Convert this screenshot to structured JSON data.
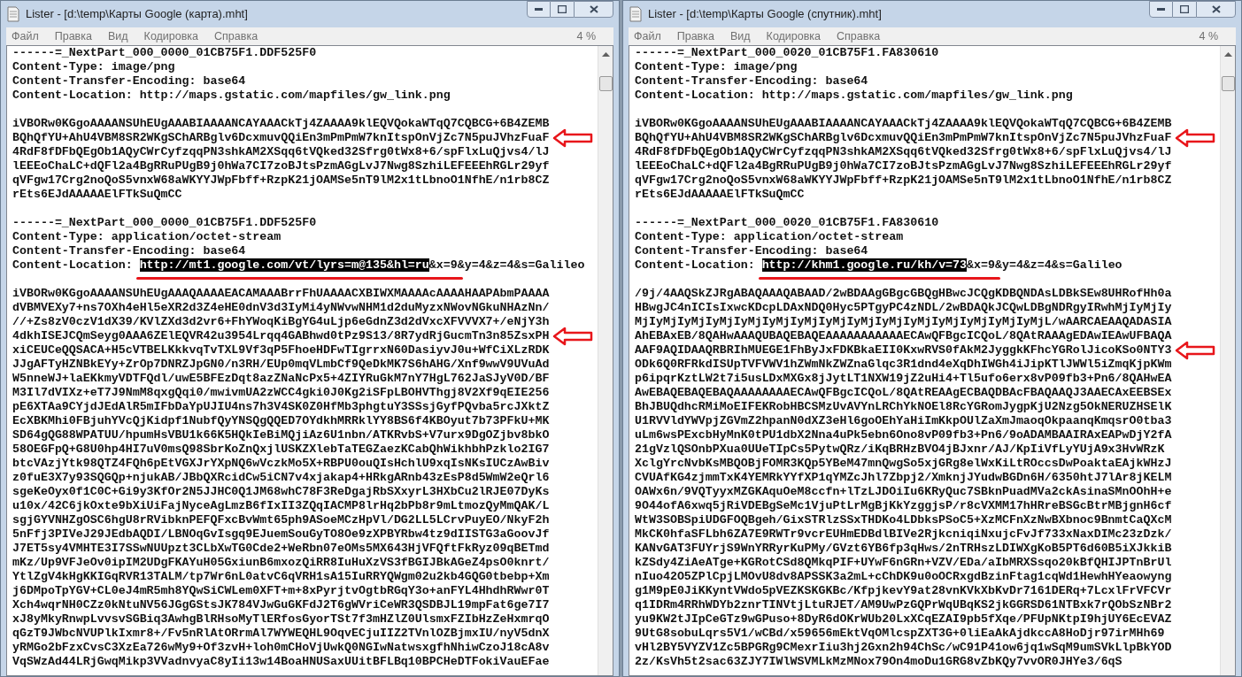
{
  "windows": [
    {
      "title": "Lister - [d:\\temp\\Карты Google (карта).mht]",
      "menu": [
        "Файл",
        "Правка",
        "Вид",
        "Кодировка",
        "Справка"
      ],
      "zoom": "4 %",
      "blocks": [
        {
          "lines": [
            {
              "kind": "plain",
              "text": "------=_NextPart_000_0000_01CB75F1.DDF525F0",
              "marked": false
            },
            {
              "kind": "plain",
              "text": "Content-Type: image/png",
              "marked": false
            },
            {
              "kind": "plain",
              "text": "Content-Transfer-Encoding: base64",
              "marked": false
            },
            {
              "kind": "plain",
              "text": "Content-Location: http://maps.gstatic.com/mapfiles/gw_link.png",
              "marked": false
            }
          ]
        },
        {
          "lines": [
            {
              "kind": "plain",
              "text": "iVBORw0KGgoAAAANSUhEUgAAABIAAAANCAYAAACkTj4ZAAAA9klEQVQokaWTqQ7CQBCG+6B4ZEMB",
              "marked": false
            },
            {
              "kind": "plain",
              "text": "BQhQfYU+AhU4VBM8SR2WKgSChARBglv6DcxmuvQQiEn3mPmPmW7knItspOnVjZc7N5puJVhzFuaF",
              "marked": true
            },
            {
              "kind": "plain",
              "text": "4RdF8fDFbQEgOb1AQyCWrCyfzqqPN3shkAM2XSqq6tVQked32Sfrg0tWx8+6/spFlxLuQjvs4/lJ",
              "marked": false
            },
            {
              "kind": "plain",
              "text": "lEEEoChaLC+dQFl2a4BgRRuPUgB9j0hWa7CI7zoBJtsPzmAGgLvJ7Nwg8SzhiLEFEEEhRGLr29yf",
              "marked": false
            },
            {
              "kind": "plain",
              "text": "qVFgw17Crg2noQoS5vnxW68aWKYYJWpFbff+RzpK21jOAMSe5nT9lM2x1tLbnoO1NfhE/n1rb8CZ",
              "marked": false
            },
            {
              "kind": "plain",
              "text": "rEts6EJdAAAAAElFTkSuQmCC",
              "marked": false
            }
          ]
        },
        {
          "lines": [
            {
              "kind": "plain",
              "text": "------=_NextPart_000_0000_01CB75F1.DDF525F0",
              "marked": false
            },
            {
              "kind": "plain",
              "text": "Content-Type: application/octet-stream",
              "marked": false
            },
            {
              "kind": "plain",
              "text": "Content-Transfer-Encoding: base64",
              "marked": false
            },
            {
              "kind": "location",
              "label": "Content-Location: ",
              "selection": "http://mt1.google.com/vt/lyrs=m@135&hl=ru",
              "rest": "&x=9&y=4&z=4&s=Galileo",
              "underlined": true,
              "marked": false
            }
          ]
        },
        {
          "lines": [
            {
              "kind": "plain",
              "text": "iVBORw0KGgoAAAANSUhEUgAAAQAAAAEACAMAAABrrFhUAAAACXBIWXMAAAAcAAAAHAAPAbmPAAAA",
              "marked": false
            },
            {
              "kind": "plain",
              "text": "dVBMVEXy7+ns7OXh4eHl5eXR2d3Z4eHE0dnV3d3IyMi4yNWvwNHM1d2duMyzxNWovNGkuNHAzNn/",
              "marked": false
            },
            {
              "kind": "plain",
              "text": "//+Zs8zV0czV1dX39/KVlZXd3d2vr6+FhYWoqKiBgYG4uLjp6eGdnZ3d2dVxcXFVVVX7+/eNjY3h",
              "marked": false
            },
            {
              "kind": "plain",
              "text": "4dkhISEJCQmSeyg0AAA6ZElEQVR42u3954Lrqq4GABhwd0tPz9S13/8R7ydRjGucmTn3n85ZsxPH",
              "marked": true
            },
            {
              "kind": "plain",
              "text": "xiCEUCeQQSACA+H5cVTBELKkkvqTvTXL9Vf3qP5FhoeHDFwTIgrrxN60DasiyvJ0u+WfCiXLzRDK",
              "marked": false
            },
            {
              "kind": "plain",
              "text": "JJgAFTyHZNBkEYy+ZrOp7DNRZJpGN0/n3RH/EUp0mqVLmbCf9QeDkMK7S6hAHG/Xnf9wwV9UVuAd",
              "marked": false
            },
            {
              "kind": "plain",
              "text": "W5nneWJ+laEKkmyVDTFQdl/uwE5BFEzDqt8azZNaNcPx5+4ZIYRuGkM7nY7HgL762JaSJyV0D/BF",
              "marked": false
            },
            {
              "kind": "plain",
              "text": "M3Il7dVIXz+eT7J9NmM8qxgQqi0/mwivmUA2zWCC4gki0J0Kg2iSFpLBOHVThgj8V2Xf9qEIE256",
              "marked": false
            },
            {
              "kind": "plain",
              "text": "pE6XTAa9CYjdJEdAlR5mIFbDaYpUJIU4ns7h3V4SK0Z0HfMb3phgtuY3SSsjGyfPQvba5rcJXktZ",
              "marked": false
            },
            {
              "kind": "plain",
              "text": "EcXBKMhi0FBjuhYVcQjKidpf1NubfQyYNSQgQQED7OYdkhMRRklYY8BS6f4KBOyut7b73PFkU+MK",
              "marked": false
            },
            {
              "kind": "plain",
              "text": "SD64gQG88WPATUU/hpumHsVBU1k66K5HQkIeBiMQjiAz6U1nbn/ATKRvbS+V7urx9DgOZjbv8bkO",
              "marked": false
            },
            {
              "kind": "plain",
              "text": "58OEGFpQ+G8U0hp4HI7uV0msQ98SbrKoZnQxjlUSKZXlebTaTEGZaezKCabQhWikhbhPzklo2IG7",
              "marked": false
            },
            {
              "kind": "plain",
              "text": "btcVAzjYtk98QTZ4FQh6pEtVGXJrYXpNQ6wVczkMo5X+RBPU0ouQIsHchlU9xqIsNKsIUCzAwBiv",
              "marked": false
            },
            {
              "kind": "plain",
              "text": "z0fuE3X7y93SQGQp+njukAB/JBbQXRcidCw5iCN7v4xjakap4+HRkgARnb43zEsP8d5WmW2eQrl6",
              "marked": false
            },
            {
              "kind": "plain",
              "text": "sgeKeOyx0f1C0C+Gi9y3KfOr2N5JJHC0Q1JM68whC78F3ReDgajRbSXxyrL3HXbCu2lRJE07DyKs",
              "marked": false
            },
            {
              "kind": "plain",
              "text": "u10x/42C6jkOxte9bXiUiFajNyceAgLmzB6fIxII3ZQqIACMP8lrHq2bPb8r9mLtmozQyMmQAK/L",
              "marked": false
            },
            {
              "kind": "plain",
              "text": "sgjGYVNHZgOSC6hgU8rRVibknPEFQFxcBvWmt65ph9ASoeMCzHpVl/DG2LL5LCrvPuyEO/NkyF2h",
              "marked": false
            },
            {
              "kind": "plain",
              "text": "5nFfj3PIVeJ29JEdbAQDI/LBNOqGvIsgq9EJuemSouGyTO8Oe9zXPBYRbw4tz9dIISTG3aGoovJf",
              "marked": false
            },
            {
              "kind": "plain",
              "text": "J7ET5sy4VMHTE3I7SSwNUUpzt3CLbXwTG0Cde2+WeRbn07eOMs5MX643HjVFQftFkRyz09qBETmd",
              "marked": false
            },
            {
              "kind": "plain",
              "text": "mKz/Up9VFJeOv0ipIM2UDgFKAYuH05GxiunB6mxozQiRR8IuHuXzVS3fBGIJBkAGeZ4psO0knrt/",
              "marked": false
            },
            {
              "kind": "plain",
              "text": "YtlZgV4kHgKKIGqRVR13TALM/tp7Wr6nL0atvC6qVRH1sA15IuRRYQWgm02u2kb4GQG0tbebp+Xm",
              "marked": false
            },
            {
              "kind": "plain",
              "text": "j6DMpoTpYGV+CL0eJ4mR5mh8YQwSiCWLem0XFT+m+8xPyrjtvOgtbRGqY3o+anFYL4HhdhRWwr0T",
              "marked": false
            },
            {
              "kind": "plain",
              "text": "Xch4wqrNH0CZz0kNtuNV56JGgGStsJK784VJwGuGKFdJ2T6gWVriCeWR3QSDBJL19mpFat6ge7I7",
              "marked": false
            },
            {
              "kind": "plain",
              "text": "xJ8yMkyRnwpLvvsvSGBiq3AwhgBlRHsoMyTlERfosGyorTSt7f3mHZlZ0UlsmxFZIbHzZeHxmrqO",
              "marked": false
            },
            {
              "kind": "plain",
              "text": "qGzT9JWbcNVUPlkIxmr8+/Fv5nRlAtORrmAl7WYWEQHL9OqvECjuIIZ2TVnlOZBjmxIU/nyV5dnX",
              "marked": false
            },
            {
              "kind": "plain",
              "text": "yRMGo2bFzxCvsC3XzEa726wMy9+Of3zvH+loh0mCHoVjUwkQ0NGIwNatwsxgfhNhiwCzoJ18cA8v",
              "marked": false
            },
            {
              "kind": "plain",
              "text": "VqSWzAd44LRjGwqMikp3VVadnvyaC8yIi13w14BoaHNUSaxUUitBFLBq10BPCHeDTFokiVauEFae",
              "marked": false
            }
          ]
        }
      ]
    },
    {
      "title": "Lister - [d:\\temp\\Карты Google (спутник).mht]",
      "menu": [
        "Файл",
        "Правка",
        "Вид",
        "Кодировка",
        "Справка"
      ],
      "zoom": "4 %",
      "blocks": [
        {
          "lines": [
            {
              "kind": "plain",
              "text": "------=_NextPart_000_0020_01CB75F1.FA830610",
              "marked": false
            },
            {
              "kind": "plain",
              "text": "Content-Type: image/png",
              "marked": false
            },
            {
              "kind": "plain",
              "text": "Content-Transfer-Encoding: base64",
              "marked": false
            },
            {
              "kind": "plain",
              "text": "Content-Location: http://maps.gstatic.com/mapfiles/gw_link.png",
              "marked": false
            }
          ]
        },
        {
          "lines": [
            {
              "kind": "plain",
              "text": "iVBORw0KGgoAAAANSUhEUgAAABIAAAANCAYAAACkTj4ZAAAA9klEQVQokaWTqQ7CQBCG+6B4ZEMB",
              "marked": false
            },
            {
              "kind": "plain",
              "text": "BQhQfYU+AhU4VBM8SR2WKgSChARBglv6DcxmuvQQiEn3mPmPmW7knItspOnVjZc7N5puJVhzFuaF",
              "marked": true
            },
            {
              "kind": "plain",
              "text": "4RdF8fDFbQEgOb1AQyCWrCyfzqqPN3shkAM2XSqq6tVQked32Sfrg0tWx8+6/spFlxLuQjvs4/lJ",
              "marked": false
            },
            {
              "kind": "plain",
              "text": "lEEEoChaLC+dQFl2a4BgRRuPUgB9j0hWa7CI7zoBJtsPzmAGgLvJ7Nwg8SzhiLEFEEEhRGLr29yf",
              "marked": false
            },
            {
              "kind": "plain",
              "text": "qVFgw17Crg2noQoS5vnxW68aWKYYJWpFbff+RzpK21jOAMSe5nT9lM2x1tLbnoO1NfhE/n1rb8CZ",
              "marked": false
            },
            {
              "kind": "plain",
              "text": "rEts6EJdAAAAAElFTkSuQmCC",
              "marked": false
            }
          ]
        },
        {
          "lines": [
            {
              "kind": "plain",
              "text": "------=_NextPart_000_0020_01CB75F1.FA830610",
              "marked": false
            },
            {
              "kind": "plain",
              "text": "Content-Type: application/octet-stream",
              "marked": false
            },
            {
              "kind": "plain",
              "text": "Content-Transfer-Encoding: base64",
              "marked": false
            },
            {
              "kind": "location",
              "label": "Content-Location: ",
              "selection": "http://khm1.google.ru/kh/v=73",
              "rest": "&x=9&y=4&z=4&s=Galileo",
              "underlined": true,
              "marked": false
            }
          ]
        },
        {
          "lines": [
            {
              "kind": "plain",
              "text": "/9j/4AAQSkZJRgABAQAAAQABAAD/2wBDAAgGBgcGBQgHBwcJCQgKDBQNDAsLDBkSEw8UHRofHh0a",
              "marked": false
            },
            {
              "kind": "plain",
              "text": "HBwgJC4nICIsIxwcKDcpLDAxNDQ0Hyc5PTgyPC4zNDL/2wBDAQkJCQwLDBgNDRgyIRwhMjIyMjIy",
              "marked": false
            },
            {
              "kind": "plain",
              "text": "MjIyMjIyMjIyMjIyMjIyMjIyMjIyMjIyMjIyMjIyMjIyMjIyMjIyMjIyMjL/wAARCAEAAQADASIA",
              "marked": false
            },
            {
              "kind": "plain",
              "text": "AhEBAxEB/8QAHwAAAQUBAQEBAQEAAAAAAAAAAAECAwQFBgcICQoL/8QAtRAAAgEDAwIEAwUFBAQA",
              "marked": false
            },
            {
              "kind": "plain",
              "text": "AAF9AQIDAAQRBRIhMUEGE1FhByJxFDKBkaEII0KxwRVS0fAkM2JyggkKFhcYGRolJicoKSo0NTY3",
              "marked": true
            },
            {
              "kind": "plain",
              "text": "ODk6Q0RFRkdISUpTVFVWV1hZWmNkZWZnaGlqc3R1dnd4eXqDhIWGh4iJipKTlJWWl5iZmqKjpKWm",
              "marked": false
            },
            {
              "kind": "plain",
              "text": "p6ipqrKztLW2t7i5usLDxMXGx8jJytLT1NXW19jZ2uHi4+Tl5ufo6erx8vP09fb3+Pn6/8QAHwEA",
              "marked": false
            },
            {
              "kind": "plain",
              "text": "AwEBAQEBAQEBAQAAAAAAAAECAwQFBgcICQoL/8QAtREAAgECBAQDBAcFBAQAAQJ3AAECAxEEBSEx",
              "marked": false
            },
            {
              "kind": "plain",
              "text": "BhJBUQdhcRMiMoEIFEKRobHBCSMzUvAVYnLRChYkNOEl8RcYGRomJygpKjU2Nzg5OkNERUZHSElK",
              "marked": false
            },
            {
              "kind": "plain",
              "text": "U1RVVldYWVpjZGVmZ2hpanN0dXZ3eHl6goOEhYaHiImKkpOUlZaXmJmaoqOkpaanqKmqsrO0tba3",
              "marked": false
            },
            {
              "kind": "plain",
              "text": "uLm6wsPExcbHyMnK0tPU1dbX2Nna4uPk5ebn6Ono8vP09fb3+Pn6/9oADAMBAAIRAxEAPwDjY2fA",
              "marked": false
            },
            {
              "kind": "plain",
              "text": "21gVzlQSOnbPXua0UUeTIpCs5PytwQRz/iKqBRHzBVO4jBJxnr/AJ/KpIiVfLyYUjA9x3HvWRzK",
              "marked": false
            },
            {
              "kind": "plain",
              "text": "XclgYrcNvbKsMBQOBjFOMR3KQp5YBeM47mnQwgSo5xjGRg8elWxKiLtROccsDwPoaktaEAjkWHzJ",
              "marked": false
            },
            {
              "kind": "plain",
              "text": "CVUAfKG4zjmmTxK4YEMRkYYfXP1qYMZcJhl7Zbpj2/XmknjJYudwBGDn6H/6350htJ7lAr8jKELM",
              "marked": false
            },
            {
              "kind": "plain",
              "text": "OAWx6n/9VQTyyxMZGKAquOeM8ccfn+lTzLJDOiIu6KRyQuc7SBknPuadMVa2ckAsinaSMnOOhH+e",
              "marked": false
            },
            {
              "kind": "plain",
              "text": "9O44ofA6xwq5jRiVDEBgSeMc1VjuPtLrMgBjKkYzggjsP/r8cVXMM17hHRreBSGcBtrMBjgnH6cf",
              "marked": false
            },
            {
              "kind": "plain",
              "text": "WtW3SOBSpiUDGFOQBgeh/GixSTRlzSSxTHDKo4LDbksPSoC5+XzMCFnXzNwBXbnoc9BnmtCaQXcM",
              "marked": false
            },
            {
              "kind": "plain",
              "text": "MkCK0hfaSFLbh6ZA7E9RWTr9vcrEUHmEDBdlBIVe2RjkcniqiNxujcFvJf733xNaxDIMc23zDzk/",
              "marked": false
            },
            {
              "kind": "plain",
              "text": "KANvGAT3FUYrjS9WnYRRyrKuPMy/GVzt6YB6fp3qHws/2nTRHszLDIWXgKoB5PT6d60B5iXJkkiB",
              "marked": false
            },
            {
              "kind": "plain",
              "text": "kZSdy4ZiAeATge+KGRotCSd8QMkqPIF+UYwF6nGRn+VZV/EDa/aIbMRXSsqo20kBfQHIJPTnBrUl",
              "marked": false
            },
            {
              "kind": "plain",
              "text": "nIuo42O5ZPlCpjLMOvU8dv8APSSK3a2mL+cChDK9u0oOCRxgdBzinFtag1cqWd1HewhHYeaowyng",
              "marked": false
            },
            {
              "kind": "plain",
              "text": "g1M9pE0JiKKyntVWdo5pVEZKSKGKBc/KfpjkevY9at28vnKVkXbKvDr7161DERq+7LcxlFrVFCVr",
              "marked": false
            },
            {
              "kind": "plain",
              "text": "q1IDRm4RRhWDYb2znrTINVtjLtuRJET/AM9UwPzGQPrWqUBqKS2jkGGRSD61NTBxk7rQObSzNBr2",
              "marked": false
            },
            {
              "kind": "plain",
              "text": "yu9KW2tJIpCeGTz9wGPuso+8DyR6dOKrWUb20LxXCqEZAI9pb5fXqe/PFUpNKtpI9hjUY6EcEVAZ",
              "marked": false
            },
            {
              "kind": "plain",
              "text": "9UtG8sobuLqrs5V1/wCBd/x59656mEktVqOMlcspZXT3G+0liEaAkAjdkccA8HoDjr97irMHh69",
              "marked": false
            },
            {
              "kind": "plain",
              "text": "vHl2BY5VYZV1Zc5BPGRg9CMexrIiu3hj2Gxn2h94ChSc/wC91P41ow6jq1wSqM9umSVkLlpBkYOD",
              "marked": false
            },
            {
              "kind": "plain",
              "text": "2z/KsVh5t2sac63ZJY7IWlWSVMLkMzMNox79On4moDu1GRG8vZbKQy7vvOR0JHYe3/6qS",
              "marked": false
            }
          ]
        }
      ]
    }
  ]
}
